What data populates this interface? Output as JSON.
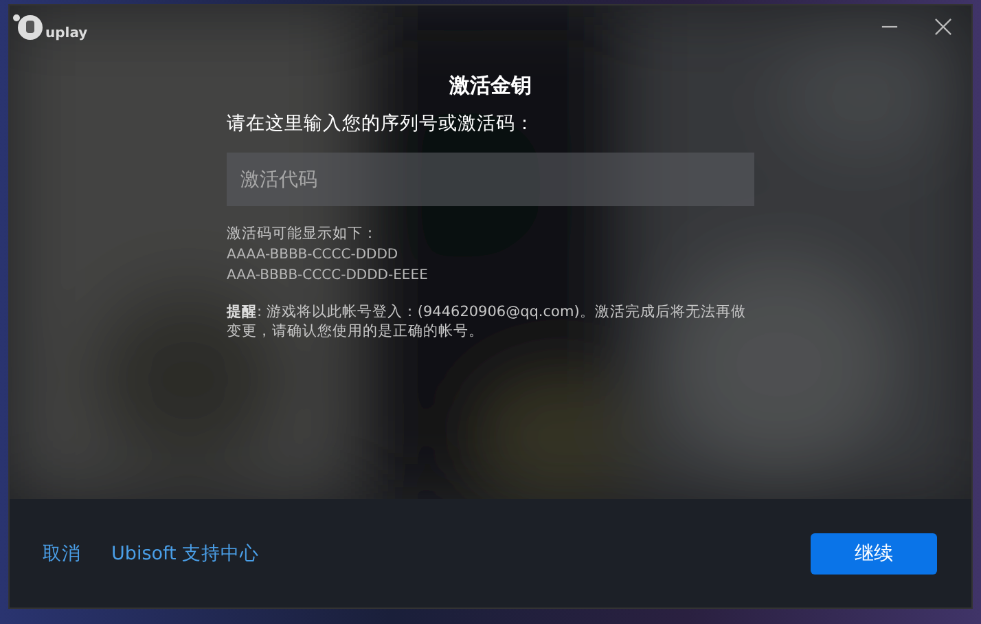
{
  "window": {
    "logo": "uplay"
  },
  "dialog": {
    "title": "激活金钥",
    "prompt": "请在这里输入您的序列号或激活码：",
    "code_field": {
      "placeholder": "激活代码"
    },
    "format_lines": [
      "激活码可能显示如下：",
      "AAAA-BBBB-CCCC-DDDD",
      "AAA-BBBB-CCCC-DDDD-EEEE"
    ],
    "notice": "**提醒**: 游戏将以此帐号登入：(944620906@qq.com)。激活完成后将无法再做变更，请确认您使用的是正确的帐号。"
  },
  "footer": {
    "links": [
      "取消",
      "Ubisoft 支持中心"
    ],
    "continue_button": "继续"
  }
}
